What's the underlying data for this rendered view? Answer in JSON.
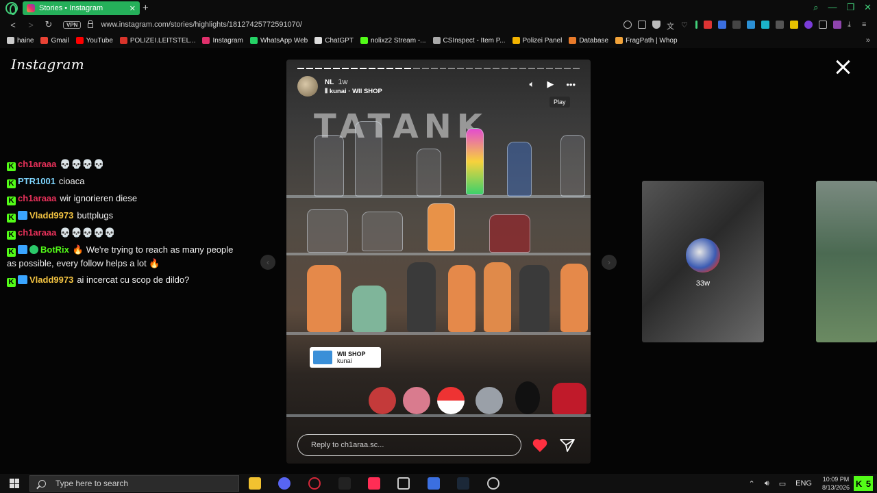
{
  "browser": {
    "tab_title": "Stories • Instagram",
    "url": "www.instagram.com/stories/highlights/18127425772591070/",
    "vpn_label": "VPN",
    "bookmarks": [
      {
        "label": "haine",
        "color": "#cccccc"
      },
      {
        "label": "Gmail",
        "color": "#ea4335"
      },
      {
        "label": "YouTube",
        "color": "#ff0000"
      },
      {
        "label": "POLIZEI.LEITSTEL...",
        "color": "#d9342b"
      },
      {
        "label": "Instagram",
        "color": "#e1306c"
      },
      {
        "label": "WhatsApp Web",
        "color": "#25d366"
      },
      {
        "label": "ChatGPT",
        "color": "#dddddd"
      },
      {
        "label": "nolixz2 Stream -...",
        "color": "#53fc18"
      },
      {
        "label": "CSInspect - Item P...",
        "color": "#aaaaaa"
      },
      {
        "label": "Polizei Panel",
        "color": "#f4b400"
      },
      {
        "label": "Database",
        "color": "#e87a2a"
      },
      {
        "label": "FragPath | Whop",
        "color": "#f2a33a"
      }
    ]
  },
  "instagram": {
    "logo": "Instagram",
    "story": {
      "username": "NL",
      "time_ago": "1w",
      "audio": "kunai · WII SHOP",
      "tooltip": "Play",
      "sign_text": "TATANK",
      "sticker_title": "WII SHOP",
      "sticker_subtitle": "kunai",
      "reply_placeholder": "Reply to ch1araa.sc..."
    },
    "side_story": {
      "time_ago": "33w"
    }
  },
  "chat": [
    {
      "user": "ch1araaa",
      "color": "#e8315a",
      "badges": [
        "kick"
      ],
      "msg": "💀💀💀💀"
    },
    {
      "user": "PTR1001",
      "color": "#7fd6ff",
      "badges": [
        "kick"
      ],
      "msg": "cioaca"
    },
    {
      "user": "ch1araaa",
      "color": "#e8315a",
      "badges": [
        "kick"
      ],
      "msg": "wir ignorieren diese"
    },
    {
      "user": "Vladd9973",
      "color": "#f5c542",
      "badges": [
        "kick",
        "sub"
      ],
      "msg": "buttplugs"
    },
    {
      "user": "ch1araaa",
      "color": "#e8315a",
      "badges": [
        "kick"
      ],
      "msg": "💀💀💀💀💀"
    },
    {
      "user": "BotRix",
      "color": "#53fc18",
      "badges": [
        "kick",
        "sub",
        "verified"
      ],
      "msg": "🔥 We're trying to reach as many people as possible, every follow helps a lot 🔥"
    },
    {
      "user": "Vladd9973",
      "color": "#f5c542",
      "badges": [
        "kick",
        "sub"
      ],
      "msg": "ai incercat cu scop de dildo?"
    }
  ],
  "taskbar": {
    "search_placeholder": "Type here to search",
    "language": "ENG",
    "time": "10:09 PM",
    "date": "8/13/2026",
    "kick_count": "5"
  },
  "colors": {
    "accent": "#25b05a",
    "kick": "#53fc18",
    "heart": "#ff3040"
  }
}
